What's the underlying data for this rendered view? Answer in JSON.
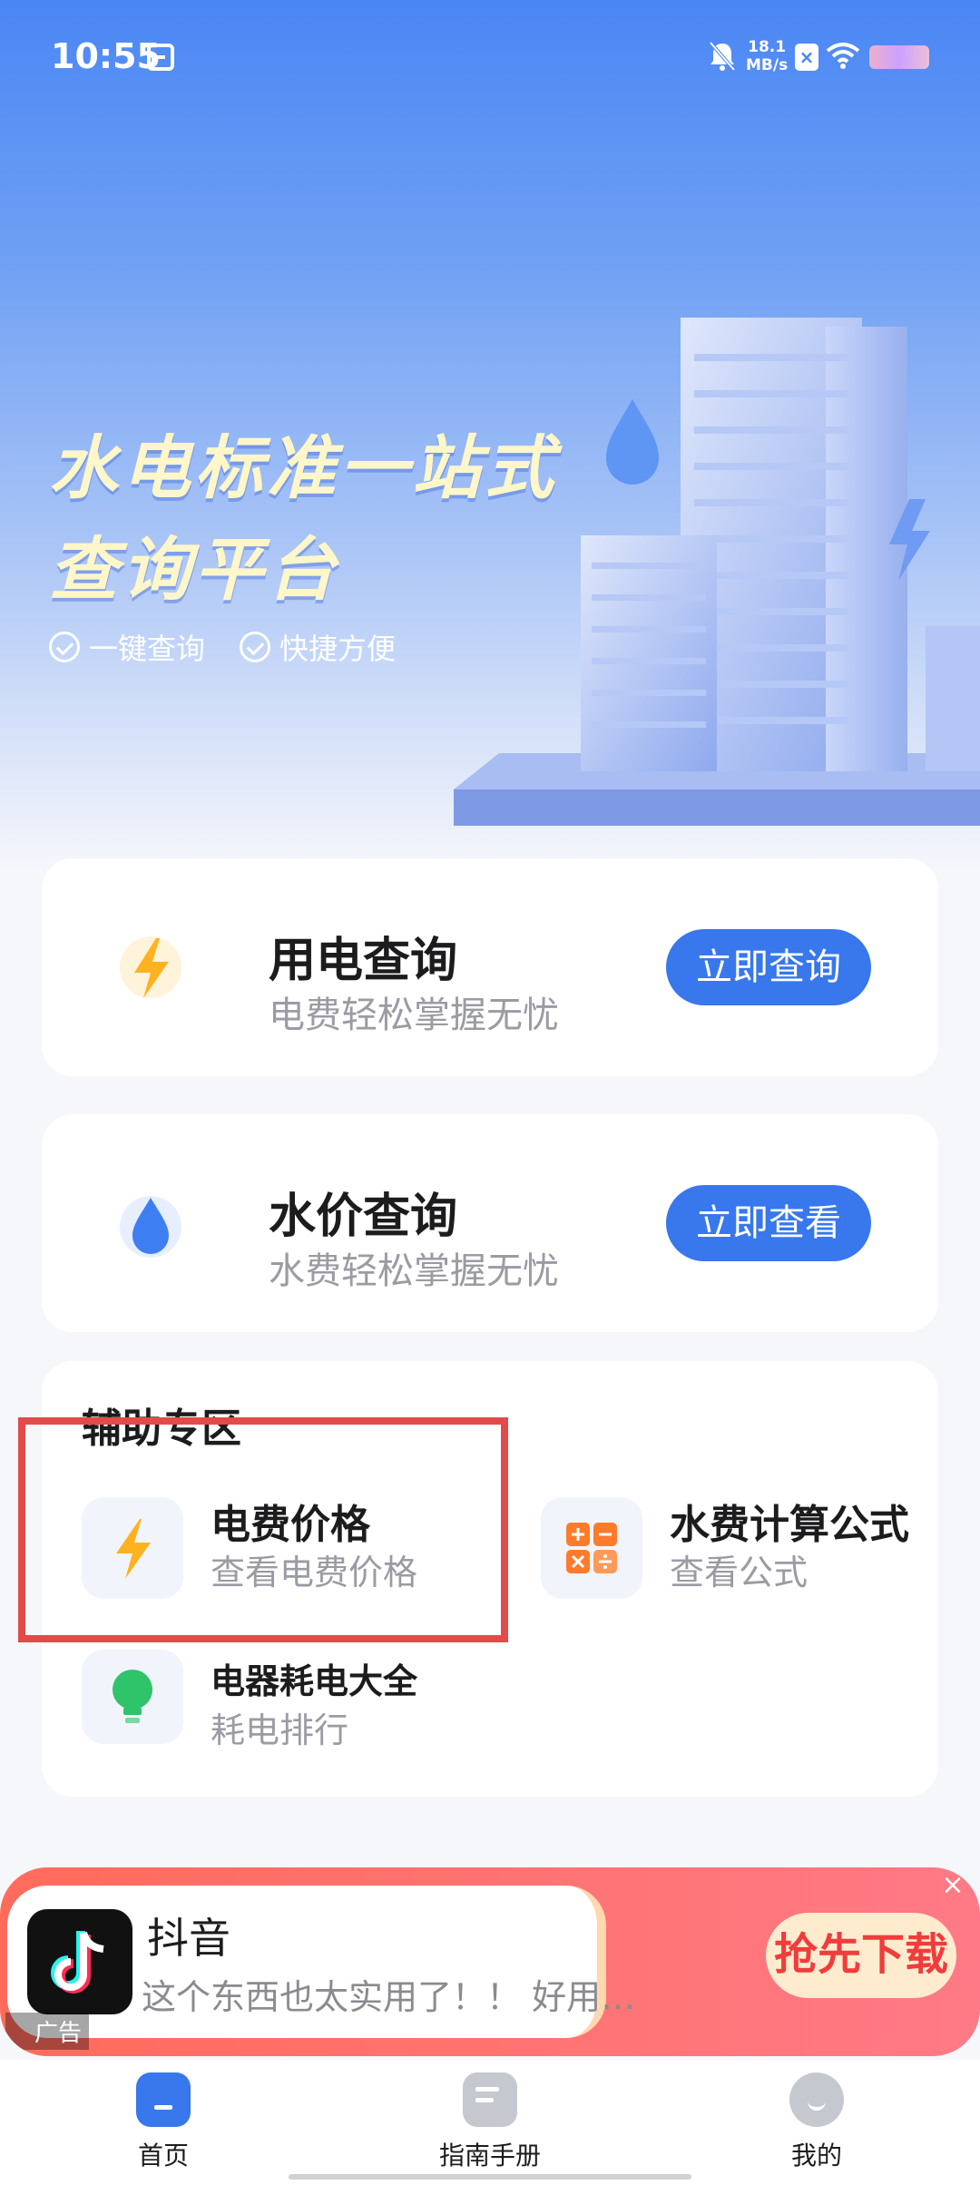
{
  "status_bar": {
    "time": "10:55",
    "net_speed_value": "18.1",
    "net_speed_unit": "MB/s"
  },
  "hero": {
    "headline_line1": "水电标准一站式",
    "headline_line2": "查询平台",
    "features": [
      "一键查询",
      "快捷方便"
    ]
  },
  "services": [
    {
      "title": "用电查询",
      "subtitle": "电费轻松掌握无忧",
      "button": "立即查询",
      "icon": "lightning-icon"
    },
    {
      "title": "水价查询",
      "subtitle": "水费轻松掌握无忧",
      "button": "立即查看",
      "icon": "water-drop-icon"
    }
  ],
  "aux_zone": {
    "title": "辅助专区",
    "tools": [
      {
        "title": "电费价格",
        "subtitle": "查看电费价格",
        "icon": "lightning-icon"
      },
      {
        "title": "水费计算公式",
        "subtitle": "查看公式",
        "icon": "calculator-icon"
      },
      {
        "title": "电器耗电大全",
        "subtitle": "耗电排行",
        "icon": "light-bulb-icon"
      }
    ]
  },
  "ad": {
    "app_name": "抖音",
    "description": "这个东西也太实用了！！ 好用…",
    "cta": "抢先下载",
    "tag": "广告",
    "close": "×"
  },
  "tabs": [
    {
      "label": "首页",
      "icon": "home-icon",
      "active": true
    },
    {
      "label": "指南手册",
      "icon": "guide-book-icon",
      "active": false
    },
    {
      "label": "我的",
      "icon": "profile-icon",
      "active": false
    }
  ],
  "colors": {
    "primary": "#3877ec",
    "highlight": "#e34a4a",
    "headline": "#fff7c9",
    "lightning": "#ffb21f",
    "ad_red": "#ff6b5b"
  }
}
